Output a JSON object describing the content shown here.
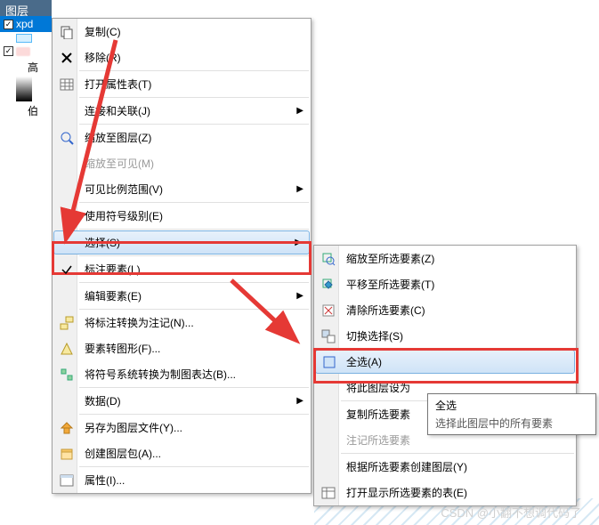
{
  "panel": {
    "title": "图层"
  },
  "layers": {
    "l1": "xpd",
    "l2_partial": "高",
    "l3_partial": "伯"
  },
  "menu1": {
    "copy": "复制(C)",
    "remove": "移除(R)",
    "open_attr": "打开属性表(T)",
    "join_relate": "连接和关联(J)",
    "zoom_layer": "缩放至图层(Z)",
    "zoom_visible": "缩放至可见(M)",
    "visible_scale": "可见比例范围(V)",
    "use_sym_level": "使用符号级别(E)",
    "select": "选择(S)",
    "label_elem": "标注要素(L)",
    "edit_elem": "编辑要素(E)",
    "convert_anno": "将标注转换为注记(N)...",
    "elem_to_fig": "要素转图形(F)...",
    "convert_sym": "将符号系统转换为制图表达(B)...",
    "data": "数据(D)",
    "saveas_lyr": "另存为图层文件(Y)...",
    "create_pkg": "创建图层包(A)...",
    "props": "属性(I)..."
  },
  "menu2": {
    "zoom_sel": "缩放至所选要素(Z)",
    "pan_sel": "平移至所选要素(T)",
    "clear_sel": "清除所选要素(C)",
    "switch_sel": "切换选择(S)",
    "select_all": "全选(A)",
    "set_layer_partial": "将此图层设为",
    "copy_sel_partial": "复制所选要素",
    "anno_sel_partial": "注记所选要素",
    "create_from_sel": "根据所选要素创建图层(Y)",
    "open_sel_table": "打开显示所选要素的表(E)"
  },
  "tooltip": {
    "title": "全选",
    "body": "选择此图层中的所有要素"
  },
  "watermark": "CSDN @小翻不想调代码了"
}
